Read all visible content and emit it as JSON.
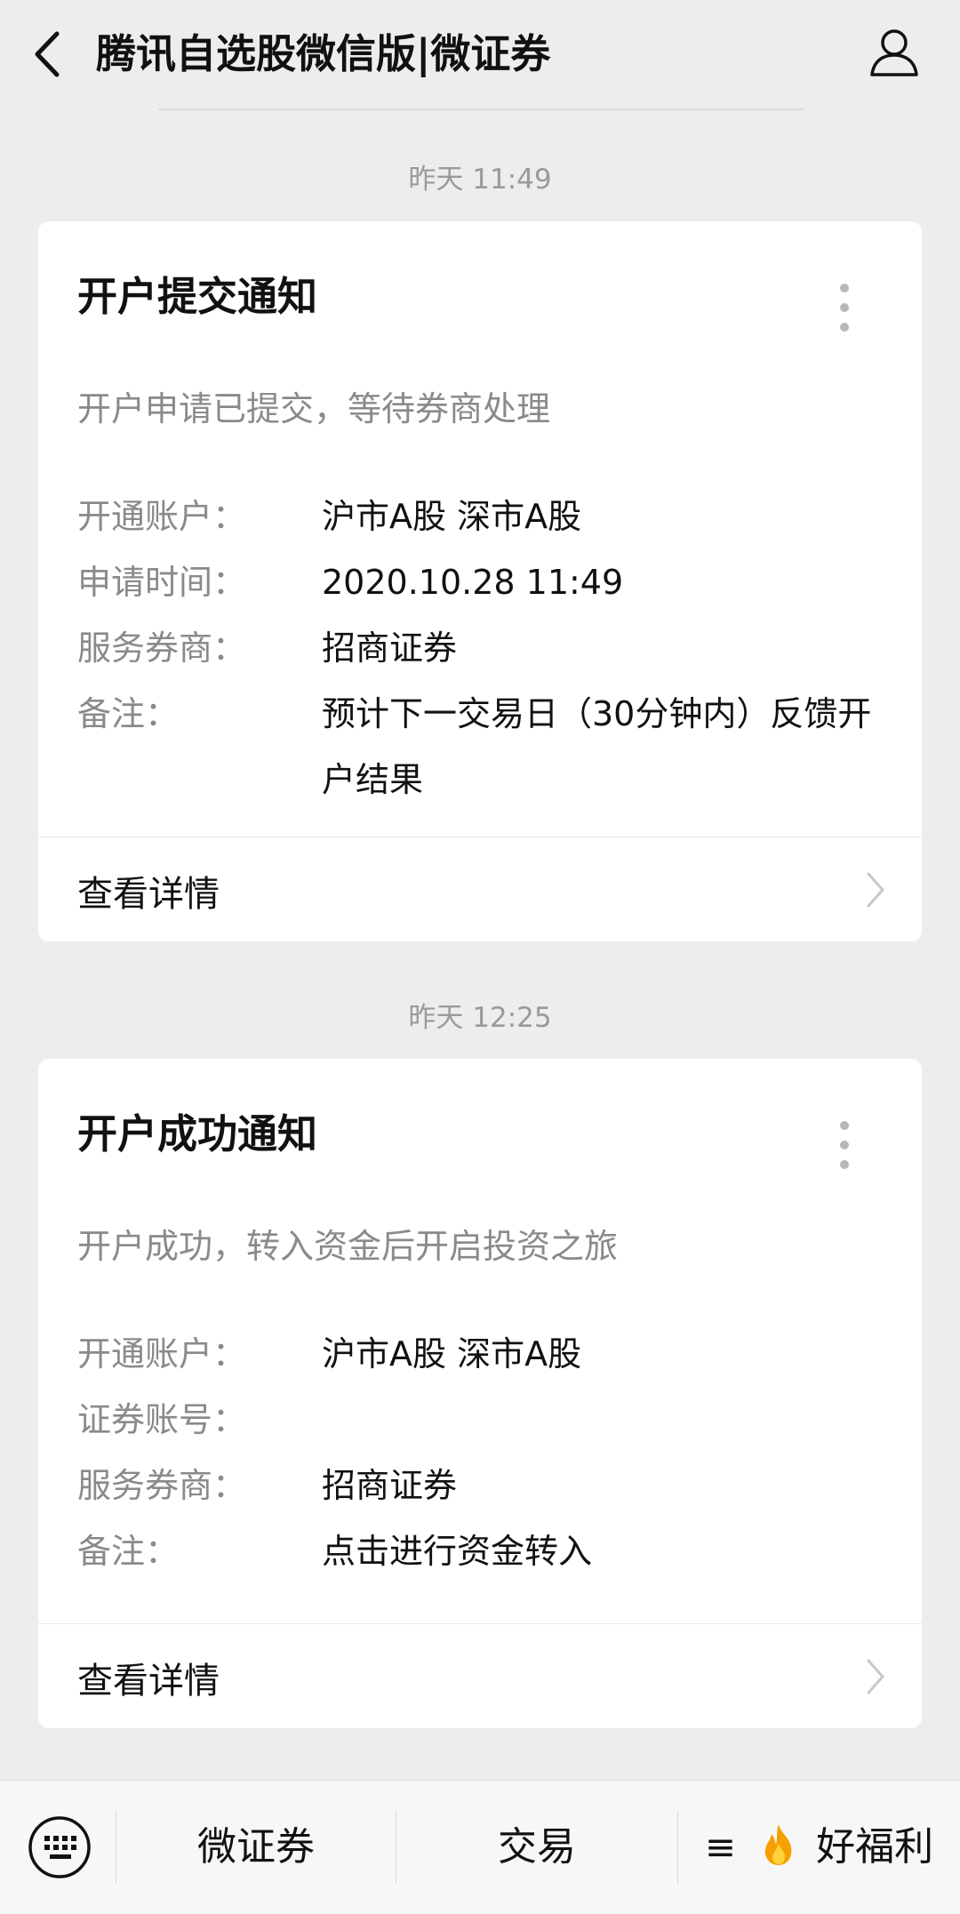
{
  "header": {
    "title": "腾讯自选股微信版|微证券"
  },
  "messages": [
    {
      "time": "昨天 11:49",
      "title": "开户提交通知",
      "description": "开户申请已提交，等待券商处理",
      "rows": [
        {
          "label": "开通账户：",
          "value": "沪市A股 深市A股"
        },
        {
          "label": "申请时间：",
          "value": "2020.10.28 11:49"
        },
        {
          "label": "服务券商：",
          "value": "招商证券"
        },
        {
          "label": "备注：",
          "value": "预计下一交易日（30分钟内）反馈开户结果"
        }
      ],
      "detail_label": "查看详情"
    },
    {
      "time": "昨天 12:25",
      "title": "开户成功通知",
      "description": "开户成功，转入资金后开启投资之旅",
      "rows": [
        {
          "label": "开通账户：",
          "value": "沪市A股 深市A股"
        },
        {
          "label": "证券账号：",
          "value": ""
        },
        {
          "label": "服务券商：",
          "value": "招商证券"
        },
        {
          "label": "备注：",
          "value": "点击进行资金转入"
        }
      ],
      "detail_label": "查看详情"
    }
  ],
  "bottom_menu": [
    {
      "label": "微证券"
    },
    {
      "label": "交易"
    },
    {
      "label": "好福利",
      "prefix": "≡"
    }
  ],
  "icons": {
    "back": "back-arrow-icon",
    "user": "user-profile-icon",
    "keyboard": "keyboard-icon",
    "fire": "fire-icon",
    "more": "more-dots-icon",
    "chevron": "chevron-right-icon"
  },
  "colors": {
    "background": "#ededed",
    "card": "#ffffff",
    "secondary_text": "#8a8a8a",
    "fire": "#f5a000"
  }
}
